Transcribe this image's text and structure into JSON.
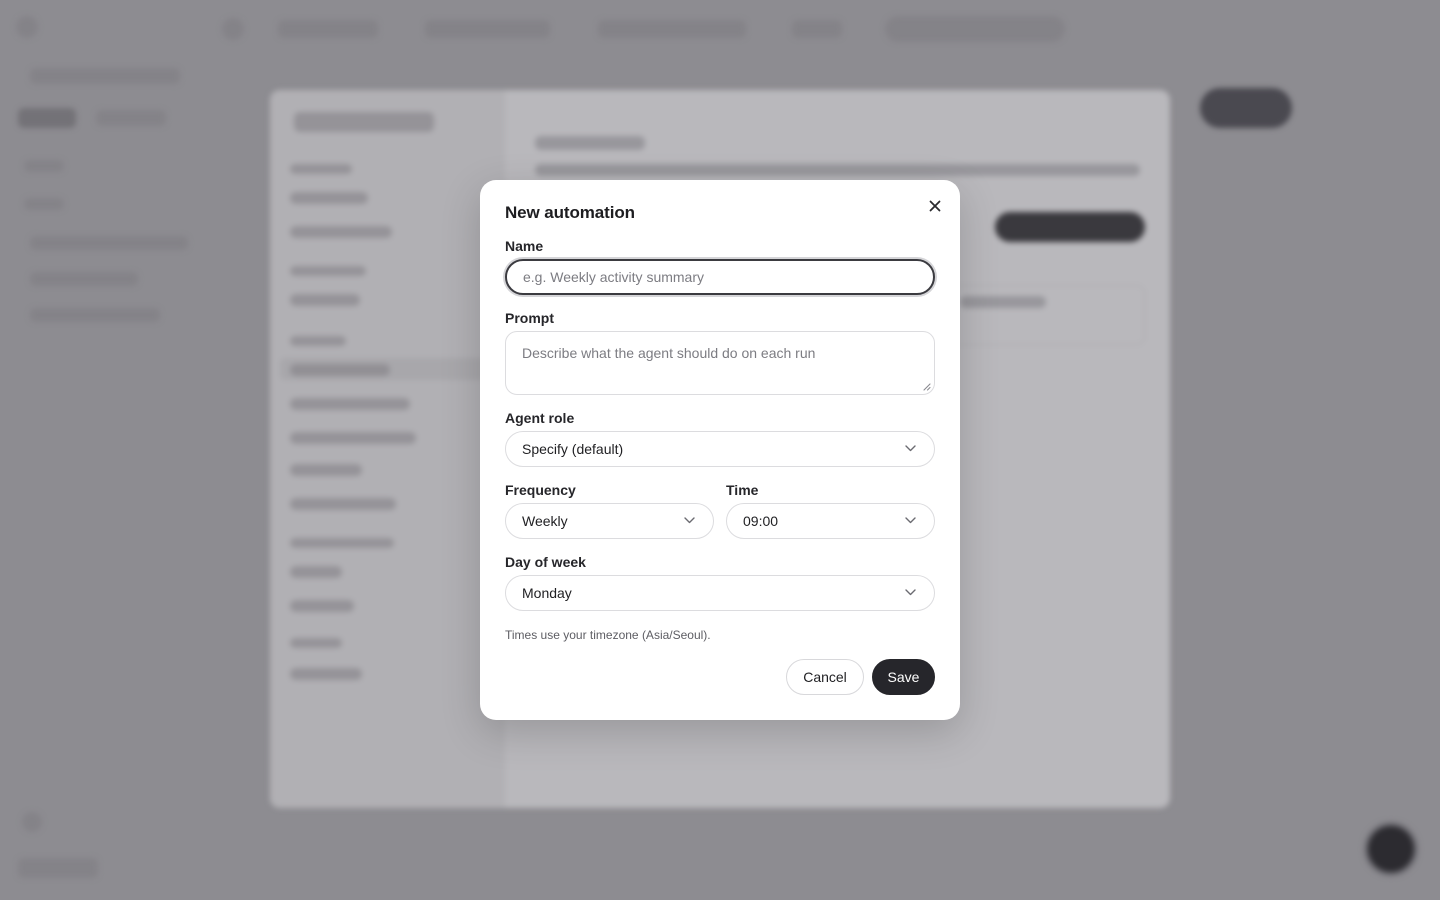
{
  "dialog": {
    "title": "New automation",
    "close_icon": "close-icon",
    "fields": {
      "name": {
        "label": "Name",
        "placeholder": "e.g. Weekly activity summary",
        "value": ""
      },
      "prompt": {
        "label": "Prompt",
        "placeholder": "Describe what the agent should do on each run",
        "value": ""
      },
      "agent_role": {
        "label": "Agent role",
        "value": "Specify (default)"
      },
      "frequency": {
        "label": "Frequency",
        "value": "Weekly"
      },
      "time": {
        "label": "Time",
        "value": "09:00"
      },
      "day_of_week": {
        "label": "Day of week",
        "value": "Monday"
      }
    },
    "hint": "Times use your timezone (Asia/Seoul).",
    "buttons": {
      "cancel": "Cancel",
      "save": "Save"
    }
  },
  "colors": {
    "overlay": "#8d8c91",
    "dialog_bg": "#ffffff",
    "primary_button": "#26262b",
    "focus_border": "#3b3b40"
  }
}
